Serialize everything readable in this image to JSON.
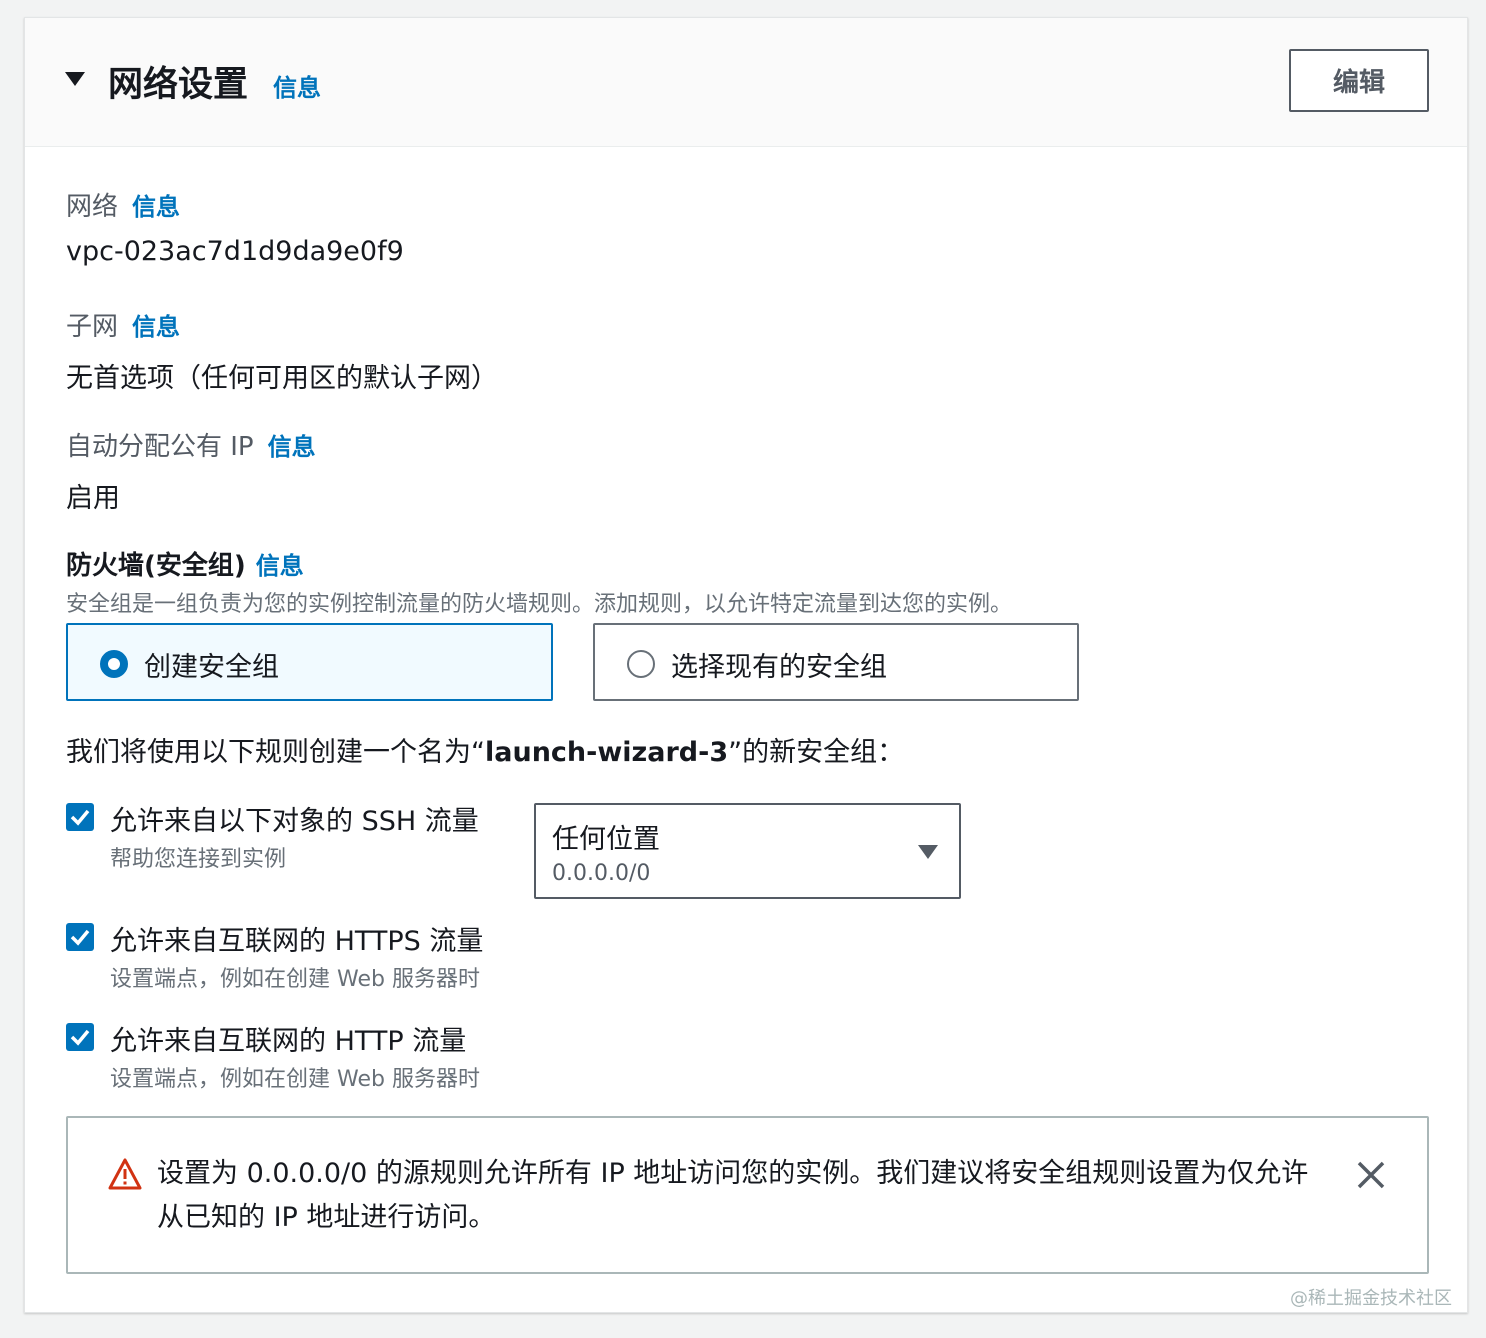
{
  "header": {
    "title": "网络设置",
    "info": "信息",
    "edit_label": "编辑"
  },
  "network": {
    "label": "网络",
    "info": "信息",
    "value": "vpc-023ac7d1d9da9e0f9"
  },
  "subnet": {
    "label": "子网",
    "info": "信息",
    "value": "无首选项（任何可用区的默认子网）"
  },
  "public_ip": {
    "label": "自动分配公有 IP",
    "info": "信息",
    "value": "启用"
  },
  "firewall": {
    "label": "防火墙(安全组)",
    "info": "信息",
    "description": "安全组是一组负责为您的实例控制流量的防火墙规则。添加规则，以允许特定流量到达您的实例。",
    "options": [
      {
        "label": "创建安全组",
        "selected": true
      },
      {
        "label": "选择现有的安全组",
        "selected": false
      }
    ],
    "create_note_prefix": "我们将使用以下规则创建一个名为“",
    "create_note_name": "launch-wizard-3",
    "create_note_suffix": "”的新安全组："
  },
  "rules": [
    {
      "label": "允许来自以下对象的 SSH 流量",
      "description": "帮助您连接到实例",
      "checked": true
    },
    {
      "label": "允许来自互联网的 HTTPS 流量",
      "description": "设置端点，例如在创建 Web 服务器时",
      "checked": true
    },
    {
      "label": "允许来自互联网的 HTTP 流量",
      "description": "设置端点，例如在创建 Web 服务器时",
      "checked": true
    }
  ],
  "ssh_source": {
    "value": "任何位置",
    "sub": "0.0.0.0/0"
  },
  "alert": {
    "text": "设置为 0.0.0.0/0 的源规则允许所有 IP 地址访问您的实例。我们建议将安全组规则设置为仅允许从已知的 IP 地址进行访问。"
  },
  "watermark": "@稀土掘金技术社区",
  "colors": {
    "accent": "#0073bb",
    "warning": "#d13212",
    "text": "#16191f",
    "muted": "#687078"
  }
}
